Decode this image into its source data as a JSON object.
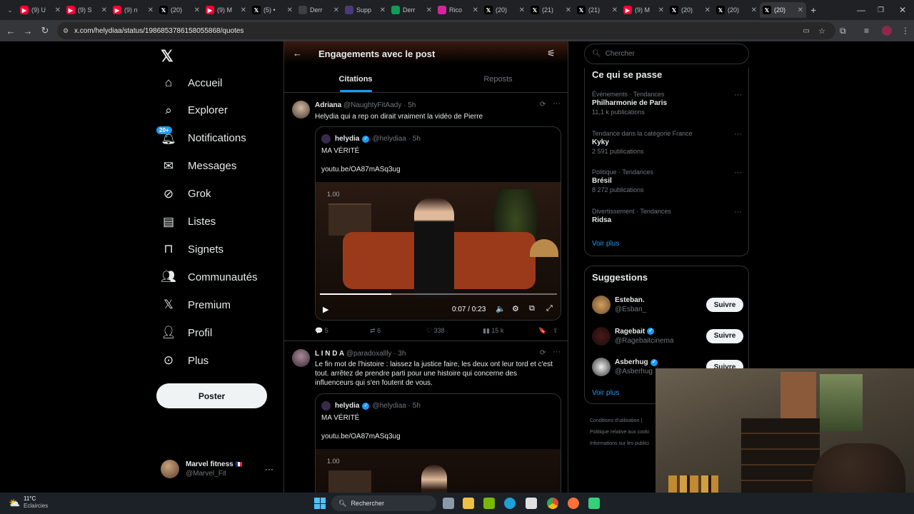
{
  "browser": {
    "tabs": [
      {
        "label": "(9) U",
        "icon": "youtube-icon",
        "color": "#ff0033"
      },
      {
        "label": "(9) S",
        "icon": "youtube-icon",
        "color": "#ff0033"
      },
      {
        "label": "(9) n",
        "icon": "youtube-icon",
        "color": "#ff0033"
      },
      {
        "label": "(20)",
        "icon": "x-icon",
        "color": "#000000"
      },
      {
        "label": "(9) M",
        "icon": "youtube-icon",
        "color": "#ff0033"
      },
      {
        "label": "(5) •",
        "icon": "x-icon",
        "color": "#000000"
      },
      {
        "label": "Derr",
        "icon": "generic-icon",
        "color": "#3c4043"
      },
      {
        "label": "Supp",
        "icon": "generic-icon",
        "color": "#4a3a7a"
      },
      {
        "label": "Derr",
        "icon": "sheet-icon",
        "color": "#0f9d58"
      },
      {
        "label": "Rico",
        "icon": "instagram-icon",
        "color": "#d6249f"
      },
      {
        "label": "(20)",
        "icon": "x-icon",
        "color": "#000000"
      },
      {
        "label": "(21)",
        "icon": "x-icon",
        "color": "#000000"
      },
      {
        "label": "(21)",
        "icon": "x-icon",
        "color": "#000000"
      },
      {
        "label": "(9) M",
        "icon": "youtube-icon",
        "color": "#ff0033"
      },
      {
        "label": "(20)",
        "icon": "x-icon",
        "color": "#000000"
      },
      {
        "label": "(20)",
        "icon": "x-icon",
        "color": "#000000"
      },
      {
        "label": "(20)",
        "icon": "x-icon",
        "color": "#000000",
        "active": true
      }
    ],
    "url": "x.com/helydiaa/status/1986853786158055868/quotes"
  },
  "nav": {
    "items": [
      {
        "label": "Accueil",
        "icon": "home-icon"
      },
      {
        "label": "Explorer",
        "icon": "search-icon"
      },
      {
        "label": "Notifications",
        "icon": "bell-icon",
        "badge": "20+"
      },
      {
        "label": "Messages",
        "icon": "mail-icon"
      },
      {
        "label": "Grok",
        "icon": "grok-icon"
      },
      {
        "label": "Listes",
        "icon": "list-icon"
      },
      {
        "label": "Signets",
        "icon": "bookmark-icon"
      },
      {
        "label": "Communautés",
        "icon": "community-icon"
      },
      {
        "label": "Premium",
        "icon": "x-icon"
      },
      {
        "label": "Profil",
        "icon": "profile-icon"
      },
      {
        "label": "Plus",
        "icon": "more-icon"
      }
    ],
    "post_button": "Poster",
    "account": {
      "name": "Marvel fitness",
      "flag": "🇫🇷",
      "handle": "@Marvel_Fit"
    }
  },
  "main": {
    "title": "Engagements avec le post",
    "tabs": [
      "Citations",
      "Reposts"
    ],
    "active_tab": "Citations",
    "tweets": [
      {
        "name": "Adriana",
        "handle": "@NaughtyFitAady",
        "time": "· 5h",
        "text": "Helydia qui a rep on dirait vraiment la vidéo de Pierre",
        "quote": {
          "name": "helydia",
          "handle": "@helydiaa · 5h",
          "text": "MA VÉRITÉ",
          "link": "youtu.be/OA87mASq3ug",
          "video_time": "0:07 / 0:23",
          "overlay": "1.00",
          "progress": 0.3
        },
        "stats": {
          "replies": "5",
          "reposts": "6",
          "likes": "338",
          "views": "15 k"
        }
      },
      {
        "name": "L I N D A",
        "handle": "@paradoxallly",
        "time": "· 3h",
        "text_lines": [
          "Le fin mot de l'histoire : laissez la justice faire, les deux ont leur tord et c'est",
          "tout. arrêtez de prendre parti pour une histoire qui concerne des",
          "influenceurs qui s'en foutent de vous."
        ],
        "quote": {
          "name": "helydia",
          "handle": "@helydiaa · 5h",
          "text": "MA VÉRITÉ",
          "link": "youtu.be/OA87mASq3ug",
          "overlay": "1.00"
        }
      }
    ]
  },
  "right": {
    "search_placeholder": "Chercher",
    "trends_title": "Ce qui se passe",
    "trends": [
      {
        "category": "Événements · Tendances",
        "name": "Philharmonie de Paris",
        "count": "11,1 k publications"
      },
      {
        "category": "Tendance dans la catégorie France",
        "name": "Kyky",
        "count": "2 591 publications"
      },
      {
        "category": "Politique · Tendances",
        "name": "Brésil",
        "count": "8 272 publications"
      },
      {
        "category": "Divertissement · Tendances",
        "name": "Ridsa",
        "count": ""
      }
    ],
    "see_more": "Voir plus",
    "suggestions_title": "Suggestions",
    "suggestions": [
      {
        "name": "Esteban.",
        "handle": "@Esban_",
        "verified": false,
        "button": "Suivre"
      },
      {
        "name": "Ragebait",
        "handle": "@Ragebaitcinema",
        "verified": true,
        "button": "Suivre"
      },
      {
        "name": "Asberhug",
        "handle": "@Asberhug",
        "verified": true,
        "button": "Suivre"
      }
    ],
    "see_more_2": "Voir plus",
    "footer": [
      "Conditions d'utilisation |",
      "Politique relative aux cooki",
      "Informations sur les publici"
    ]
  },
  "taskbar": {
    "weather_temp": "11°C",
    "weather_desc": "Eclaircies",
    "search": "Rechercher"
  },
  "colors": {
    "accent": "#1d9bf0",
    "bg": "#000000",
    "border": "#2f3336",
    "muted": "#71767b"
  }
}
